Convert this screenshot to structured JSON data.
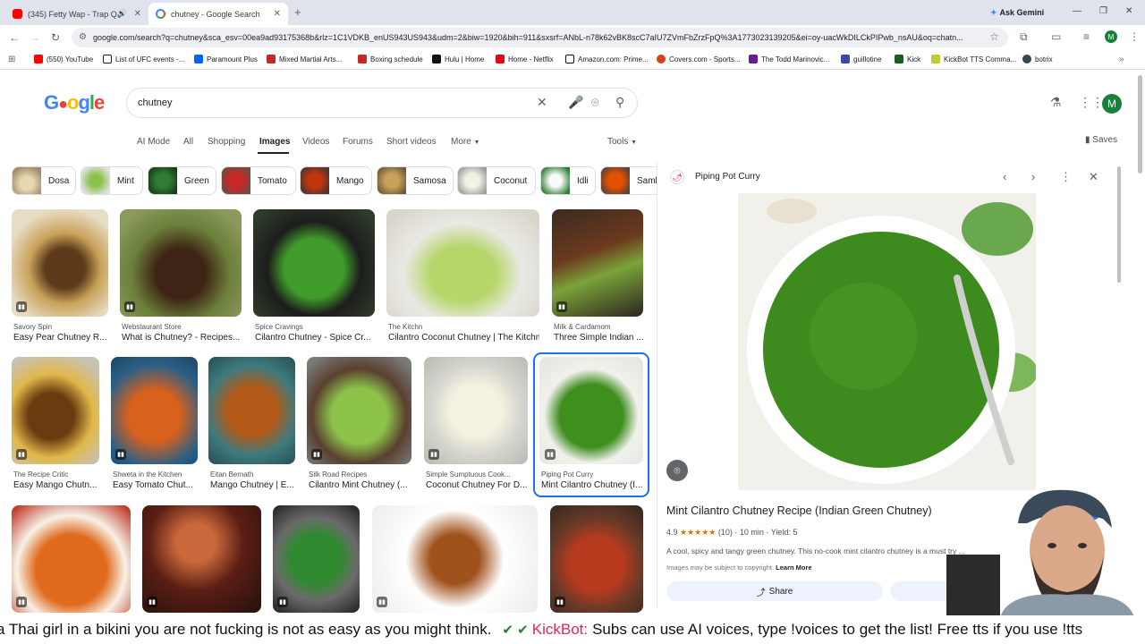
{
  "browser": {
    "tabs": [
      {
        "title": "(345) Fetty Wap - Trap Queen",
        "favicon": "youtube-icon",
        "active": false
      },
      {
        "title": "chutney - Google Search",
        "favicon": "google-icon",
        "active": true
      }
    ],
    "ask_gemini": "Ask Gemini",
    "url": "google.com/search?q=chutney&sca_esv=00ea9ad93175368b&rlz=1C1VDKB_enUS943US943&udm=2&biw=1920&bih=911&sxsrf=ANbL-n78k62vBK8scC7aIU7ZVmFbZrzFpQ%3A1773023139205&ei=oy-uacWkDILCkPIPwb_nsAU&oq=chatn...",
    "profile_initial": "M",
    "bookmarks": [
      {
        "label": "(550) YouTube",
        "color": "#ff0000"
      },
      {
        "label": "List of UFC events -...",
        "color": "#202124"
      },
      {
        "label": "Paramount Plus",
        "color": "#0064ff"
      },
      {
        "label": "Mixed Martial Arts...",
        "color": "#c62828"
      },
      {
        "label": "Boxing schedule",
        "color": "#c62828"
      },
      {
        "label": "Hulu | Home",
        "color": "#111111"
      },
      {
        "label": "Home - Netflix",
        "color": "#e50914"
      },
      {
        "label": "Amazon.com: Prime...",
        "color": "#111111"
      },
      {
        "label": "Covers.com - Sports...",
        "color": "#d84315"
      },
      {
        "label": "The Todd Marinovic...",
        "color": "#6a1b9a"
      },
      {
        "label": "guillotine",
        "color": "#3949ab"
      },
      {
        "label": "Kick",
        "color": "#1b5e20"
      },
      {
        "label": "KickBot TTS Comma...",
        "color": "#c0ca33"
      },
      {
        "label": "botrix",
        "color": "#37474f"
      }
    ]
  },
  "google": {
    "logo": "Google",
    "query": "chutney",
    "nav_tabs": [
      "AI Mode",
      "All",
      "Shopping",
      "Images",
      "Videos",
      "Forums",
      "Short videos",
      "More"
    ],
    "active_tab": "Images",
    "tools": "Tools",
    "saves": "Saves",
    "chips": [
      "Dosa",
      "Mint",
      "Green",
      "Tomato",
      "Mango",
      "Samosa",
      "Coconut",
      "Idli",
      "Sambar"
    ]
  },
  "results": [
    {
      "source": "Savory Spin",
      "title": "Easy Pear Chutney R..."
    },
    {
      "source": "Webstaurant Store",
      "title": "What is Chutney? - Recipes..."
    },
    {
      "source": "Spice Cravings",
      "title": "Cilantro Chutney - Spice Cr..."
    },
    {
      "source": "The Kitchn",
      "title": "Cilantro Coconut Chutney | The Kitchn"
    },
    {
      "source": "Milk & Cardamom",
      "title": "Three Simple Indian ..."
    },
    {
      "source": "The Recipe Critic",
      "title": "Easy Mango Chutn..."
    },
    {
      "source": "Shweta in the Kitchen",
      "title": "Easy Tomato Chut..."
    },
    {
      "source": "Eitan Bernath",
      "title": "Mango Chutney | E..."
    },
    {
      "source": "Silk Road Recipes",
      "title": "Cilantro Mint Chutney (..."
    },
    {
      "source": "Simple Sumptuous Cook...",
      "title": "Coconut Chutney For D..."
    },
    {
      "source": "Piping Pot Curry",
      "title": "Mint Cilantro Chutney (I..."
    }
  ],
  "panel": {
    "source": "Piping Pot Curry",
    "title": "Mint Cilantro Chutney Recipe (Indian Green Chutney)",
    "rating": "4.9",
    "stars": "★★★★★",
    "reviews": "(10)",
    "time": "10 min",
    "yield": "Yield: 5",
    "description": "A cool, spicy and tangy green chutney. This no-cook mint cilantro chutney is a must try ...",
    "copyright": "Images may be subject to copyright.",
    "learn_more": "Learn More",
    "share": "Share"
  },
  "ticker": {
    "text1": "a Thai girl in a bikini you are not fucking is not as easy as you might think.",
    "emoji": "✔ ✔",
    "bot": "KickBot:",
    "text2": "Subs can use AI voices, type !voices to get the list! Free tts if you use !tts"
  }
}
